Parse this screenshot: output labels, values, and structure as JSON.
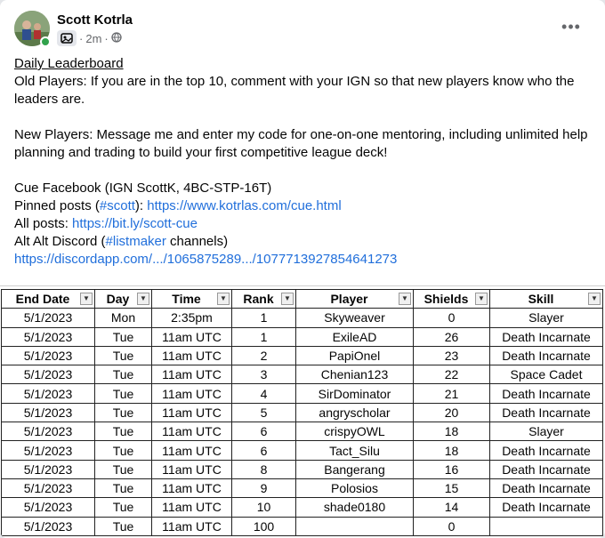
{
  "post": {
    "author": "Scott Kotrla",
    "time": "2m",
    "middot": "·",
    "more_label": "•••"
  },
  "content": {
    "title": "Daily Leaderboard",
    "old_players": "Old Players: If you are in the top 10, comment with your IGN so that new players know who the",
    "old_players_2": "leaders are.",
    "new_players": "New Players: Message me and enter my code for one-on-one mentoring, including unlimited help",
    "new_players_2": "planning and trading to build your first competitive league deck!",
    "cue_fb": "Cue Facebook (IGN ScottK, 4BC-STP-16T)",
    "pinned_prefix": "Pinned posts (",
    "pinned_tag": "#scott",
    "pinned_mid": "): ",
    "pinned_link": "https://www.kotrlas.com/cue.html",
    "all_prefix": "All posts: ",
    "all_link": "https://bit.ly/scott-cue",
    "alt_prefix": "Alt Alt Discord (",
    "alt_tag": "#listmaker",
    "alt_suffix": " channels)",
    "discord_link": "https://discordapp.com/.../1065875289.../1077713927854641273"
  },
  "table": {
    "headers": [
      "End Date",
      "Day",
      "Time",
      "Rank",
      "Player",
      "Shields",
      "Skill"
    ],
    "filter_icons": [
      "▼",
      "▼",
      "▼",
      "▼",
      "▼",
      "▼",
      "▼"
    ],
    "rows": [
      [
        "5/1/2023",
        "Mon",
        "2:35pm",
        "1",
        "Skyweaver",
        "0",
        "Slayer"
      ],
      [
        "5/1/2023",
        "Tue",
        "11am UTC",
        "1",
        "ExileAD",
        "26",
        "Death Incarnate"
      ],
      [
        "5/1/2023",
        "Tue",
        "11am UTC",
        "2",
        "PapiOnel",
        "23",
        "Death Incarnate"
      ],
      [
        "5/1/2023",
        "Tue",
        "11am UTC",
        "3",
        "Chenian123",
        "22",
        "Space Cadet"
      ],
      [
        "5/1/2023",
        "Tue",
        "11am UTC",
        "4",
        "SirDominator",
        "21",
        "Death Incarnate"
      ],
      [
        "5/1/2023",
        "Tue",
        "11am UTC",
        "5",
        "angryscholar",
        "20",
        "Death Incarnate"
      ],
      [
        "5/1/2023",
        "Tue",
        "11am UTC",
        "6",
        "crispyOWL",
        "18",
        "Slayer"
      ],
      [
        "5/1/2023",
        "Tue",
        "11am UTC",
        "6",
        "Tact_Silu",
        "18",
        "Death Incarnate"
      ],
      [
        "5/1/2023",
        "Tue",
        "11am UTC",
        "8",
        "Bangerang",
        "16",
        "Death Incarnate"
      ],
      [
        "5/1/2023",
        "Tue",
        "11am UTC",
        "9",
        "Polosios",
        "15",
        "Death Incarnate"
      ],
      [
        "5/1/2023",
        "Tue",
        "11am UTC",
        "10",
        "shade0180",
        "14",
        "Death Incarnate"
      ],
      [
        "5/1/2023",
        "Tue",
        "11am UTC",
        "100",
        "",
        "0",
        ""
      ]
    ]
  }
}
